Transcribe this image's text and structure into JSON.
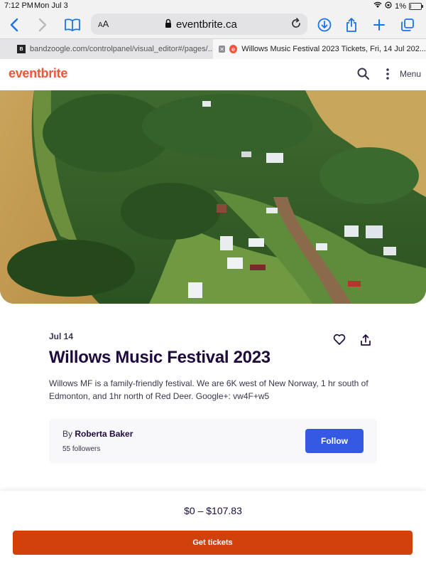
{
  "status": {
    "time": "7:12 PM",
    "date": "Mon Jul 3",
    "battery": "1%",
    "battery_level": 0.01
  },
  "browser": {
    "aa_label": "AA",
    "url": "eventbrite.ca",
    "tabs": [
      {
        "title": "bandzoogle.com/controlpanel/visual_editor#/pages/...",
        "favicon": "B"
      },
      {
        "title": "Willows Music Festival 2023 Tickets, Fri, 14 Jul 202...",
        "favicon": "e"
      }
    ]
  },
  "site": {
    "logo": "eventbrite",
    "menu_label": "Menu"
  },
  "event": {
    "date": "Jul 14",
    "title": "Willows Music Festival 2023",
    "summary": "Willows MF is a family-friendly festival. We are 6K west of New Norway, 1 hr south of Edmonton, and 1hr north of Red Deer. Google+: vw4F+w5",
    "organizer_prefix": "By",
    "organizer_name": "Roberta Baker",
    "followers": "55 followers",
    "follow_label": "Follow"
  },
  "checkout": {
    "price_range": "$0 – $107.83",
    "button_label": "Get tickets"
  },
  "colors": {
    "brand": "#f05537",
    "follow": "#3659e3",
    "cta": "#d1410c",
    "ios_blue": "#1a73e8"
  }
}
